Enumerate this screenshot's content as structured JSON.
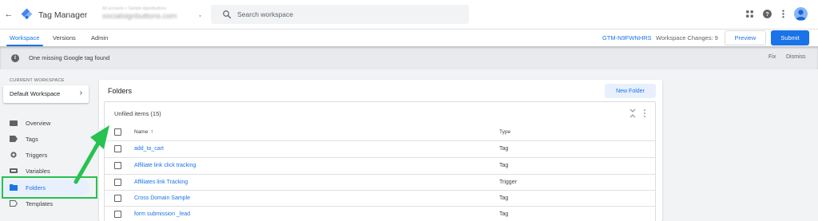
{
  "header": {
    "back_label": "←",
    "app_title": "Tag Manager",
    "account": {
      "line1": "All accounts > Sample Agnolbuttons",
      "line2": "socialsignbuttons.com",
      "caret": "▾"
    },
    "search": {
      "placeholder": "Search workspace"
    }
  },
  "tabs": [
    {
      "label": "Workspace",
      "active": true
    },
    {
      "label": "Versions",
      "active": false
    },
    {
      "label": "Admin",
      "active": false
    }
  ],
  "container_id": "GTM-N9FWNHRS",
  "workspace_changes": "Workspace Changes: 9",
  "buttons": {
    "preview": "Preview",
    "submit": "Submit",
    "new_folder": "New Folder"
  },
  "notice": {
    "text": "One missing Google tag found",
    "fix": "Fix",
    "dismiss": "Dismiss",
    "icon": "i"
  },
  "sidebar": {
    "current_workspace_label": "CURRENT WORKSPACE",
    "workspace_name": "Default Workspace",
    "chevron": "›",
    "items": [
      {
        "label": "Overview",
        "icon": "overview-icon"
      },
      {
        "label": "Tags",
        "icon": "tag-icon"
      },
      {
        "label": "Triggers",
        "icon": "trigger-icon"
      },
      {
        "label": "Variables",
        "icon": "variables-icon"
      },
      {
        "label": "Folders",
        "icon": "folder-icon",
        "active": true
      },
      {
        "label": "Templates",
        "icon": "templates-icon"
      }
    ]
  },
  "panel": {
    "title": "Folders",
    "card_title": "Unfiled items (15)",
    "columns": {
      "name": "Name",
      "sort": "↑",
      "type": "Type"
    },
    "rows": [
      {
        "name": "add_to_cart",
        "type": "Tag"
      },
      {
        "name": "Affiliate link click tracking",
        "type": "Tag"
      },
      {
        "name": "Affiliates link Tracking",
        "type": "Trigger"
      },
      {
        "name": "Cross Domain Sample",
        "type": "Tag"
      },
      {
        "name": "form submission _lead",
        "type": "Tag"
      }
    ]
  },
  "colors": {
    "accent": "#1a73e8",
    "annotation": "#27c251",
    "active_bg": "#e8f0fe"
  }
}
